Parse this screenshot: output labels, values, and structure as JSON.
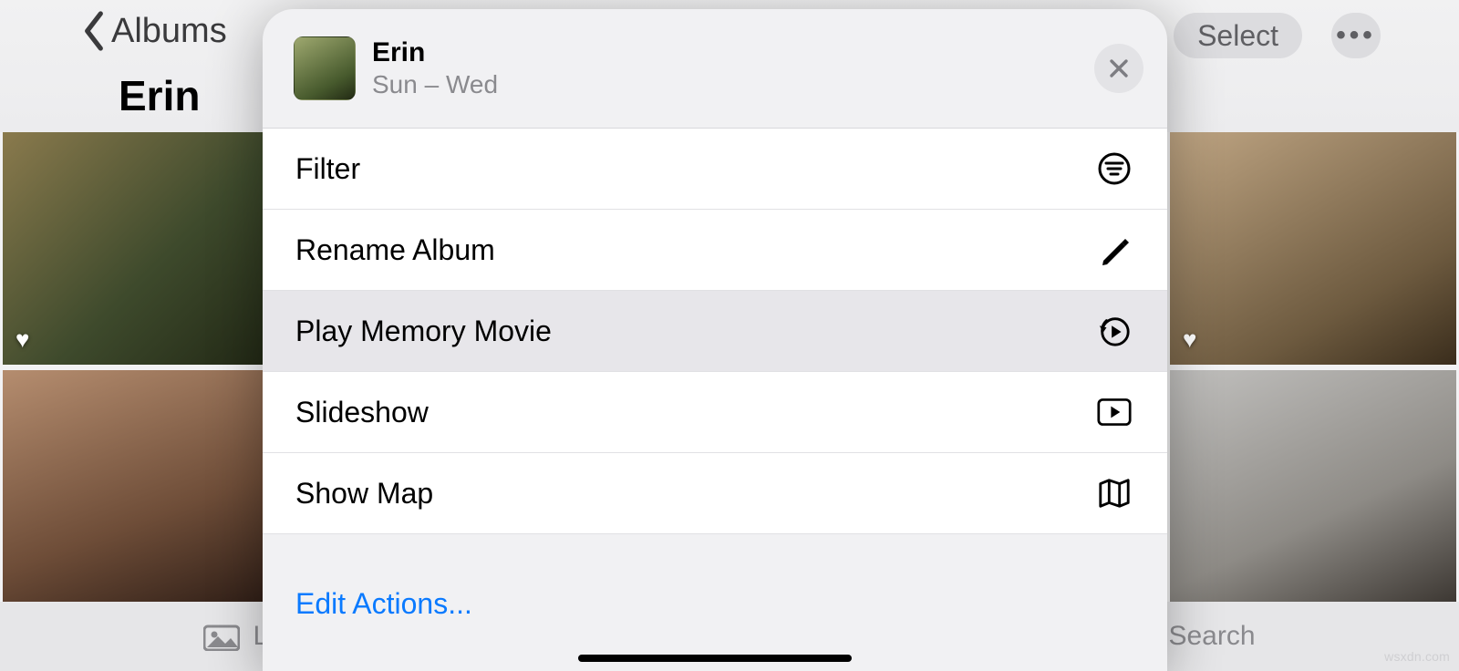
{
  "nav": {
    "back_label": "Albums",
    "title": "Erin",
    "select_label": "Select"
  },
  "tabs": {
    "library_label": "Li",
    "search_label": "Search"
  },
  "sheet": {
    "title": "Erin",
    "subtitle": "Sun – Wed",
    "actions": {
      "filter": "Filter",
      "rename": "Rename Album",
      "memory": "Play Memory Movie",
      "slideshow": "Slideshow",
      "showmap": "Show Map"
    },
    "edit_link": "Edit Actions..."
  },
  "watermark": "wsxdn.com"
}
